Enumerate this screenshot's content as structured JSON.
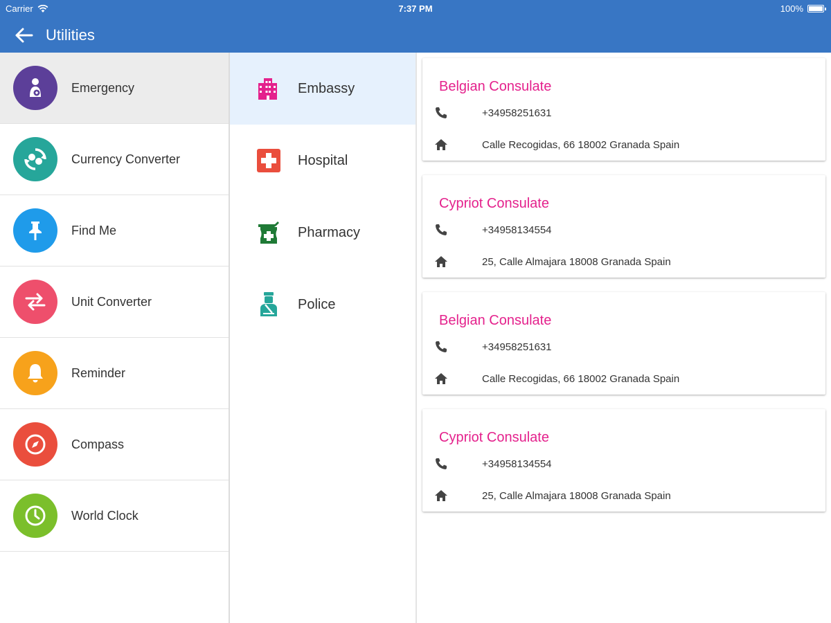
{
  "status_bar": {
    "carrier": "Carrier",
    "time": "7:37 PM",
    "battery": "100%"
  },
  "header": {
    "title": "Utilities"
  },
  "utilities": [
    {
      "label": "Emergency",
      "icon": "emergency-icon",
      "color": "#5c3f99",
      "active": true
    },
    {
      "label": "Currency Converter",
      "icon": "currency-icon",
      "color": "#26a69a",
      "active": false
    },
    {
      "label": "Find Me",
      "icon": "pin-icon",
      "color": "#1f9bea",
      "active": false
    },
    {
      "label": "Unit Converter",
      "icon": "swap-icon",
      "color": "#ee4f6c",
      "active": false
    },
    {
      "label": "Reminder",
      "icon": "bell-icon",
      "color": "#f7a21b",
      "active": false
    },
    {
      "label": "Compass",
      "icon": "compass-icon",
      "color": "#ea4e3d",
      "active": false
    },
    {
      "label": "World Clock",
      "icon": "clock-icon",
      "color": "#7bbf2b",
      "active": false
    }
  ],
  "categories": [
    {
      "label": "Embassy",
      "icon": "building-icon",
      "color": "#e4218c",
      "active": true
    },
    {
      "label": "Hospital",
      "icon": "hospital-cross-icon",
      "color": "#ea4e3d",
      "active": false
    },
    {
      "label": "Pharmacy",
      "icon": "pharmacy-icon",
      "color": "#1f7a36",
      "active": false
    },
    {
      "label": "Police",
      "icon": "police-icon",
      "color": "#26a69a",
      "active": false
    }
  ],
  "contacts": [
    {
      "name": "Belgian Consulate",
      "phone": "+34958251631",
      "address": "Calle Recogidas, 66 18002 Granada Spain"
    },
    {
      "name": "Cypriot Consulate",
      "phone": "+34958134554",
      "address": "25, Calle Almajara 18008 Granada Spain"
    },
    {
      "name": "Belgian Consulate",
      "phone": "+34958251631",
      "address": "Calle Recogidas, 66 18002 Granada Spain"
    },
    {
      "name": "Cypriot Consulate",
      "phone": "+34958134554",
      "address": "25, Calle Almajara 18008 Granada Spain"
    }
  ],
  "colors": {
    "header": "#3876c4",
    "accent": "#e4218c",
    "active_item": "#ececec",
    "active_category": "#e6f1fd"
  }
}
